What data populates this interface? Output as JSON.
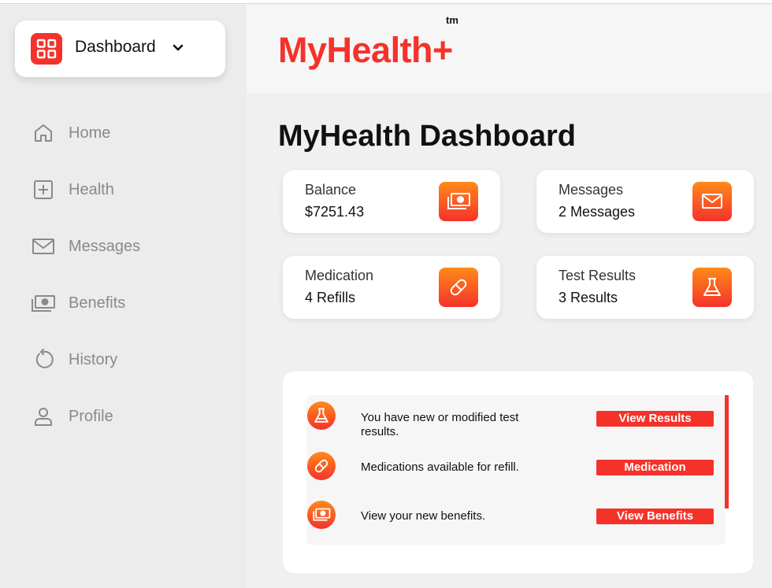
{
  "sidebar": {
    "dashboard_label": "Dashboard",
    "items": [
      {
        "label": "Home",
        "icon": "home-icon"
      },
      {
        "label": "Health",
        "icon": "plus-square-icon"
      },
      {
        "label": "Messages",
        "icon": "mail-icon"
      },
      {
        "label": "Benefits",
        "icon": "cash-icon"
      },
      {
        "label": "History",
        "icon": "history-icon"
      },
      {
        "label": "Profile",
        "icon": "user-icon"
      }
    ]
  },
  "header": {
    "logo": "MyHealth+",
    "tm": "tm"
  },
  "main": {
    "title": "MyHealth Dashboard",
    "cards": [
      {
        "title": "Balance",
        "value": "$7251.43",
        "icon": "cash-icon"
      },
      {
        "title": "Messages",
        "value": "2 Messages",
        "icon": "mail-icon"
      },
      {
        "title": "Medication",
        "value": "4 Refills",
        "icon": "pill-icon"
      },
      {
        "title": "Test Results",
        "value": "3 Results",
        "icon": "flask-icon"
      }
    ],
    "notifications": [
      {
        "text": "You have new or modified test results.",
        "button": "View Results",
        "icon": "flask-icon"
      },
      {
        "text": "Medications available for refill.",
        "button": "Medication",
        "icon": "pill-icon"
      },
      {
        "text": "View your new benefits.",
        "button": "View Benefits",
        "icon": "cash-icon"
      }
    ]
  },
  "colors": {
    "accent": "#f5322a",
    "accent_gradient_top": "#ff8a1a",
    "sidebar_bg": "#ececec",
    "nav_text": "#8a8a8a"
  }
}
